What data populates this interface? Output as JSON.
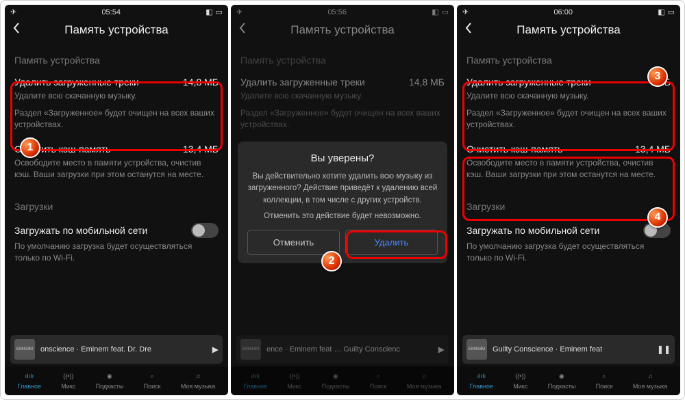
{
  "header_title": "Память устройства",
  "section_storage": "Память устройства",
  "section_downloads": "Загрузки",
  "delete_tracks": {
    "title": "Удалить загруженные треки",
    "size_full": "14,8 МБ",
    "size_empty": "0 Б",
    "line1": "Удалите всю скачанную музыку.",
    "line2": "Раздел «Загруженное» будет очищен на всех ваших устройствах."
  },
  "clear_cache": {
    "title": "Очистить кэш-память",
    "size": "13,4 МБ",
    "desc": "Освободите место в памяти устройства, очистив кэш. Ваши загрузки при этом останутся на месте."
  },
  "cellular": {
    "title": "Загружать по мобильной сети",
    "desc": "По умолчанию загрузка будет осуществляться только по Wi-Fi."
  },
  "modal": {
    "title": "Вы уверены?",
    "body": "Вы действительно хотите удалить всю музыку из загруженного? Действие приведёт к удалению всей коллекции, в том числе с других устройств.",
    "note": "Отменить это действие будет невозможно.",
    "cancel": "Отменить",
    "delete": "Удалить"
  },
  "times": {
    "p1": "05:54",
    "p2": "05:56",
    "p3": "06:00"
  },
  "player": {
    "cover": "EMINƎM",
    "p1": "onscience · Eminem feat. Dr. Dre",
    "p2": "ence · Eminem feat … Guilty Conscienc",
    "p3": "Guilty Conscience · Eminem feat"
  },
  "tabs": {
    "home": "Главное",
    "mix": "Микс",
    "podcasts": "Подкасты",
    "search": "Поиск",
    "my": "Моя музыка"
  },
  "badges": {
    "b1": "1",
    "b2": "2",
    "b3": "3",
    "b4": "4"
  }
}
